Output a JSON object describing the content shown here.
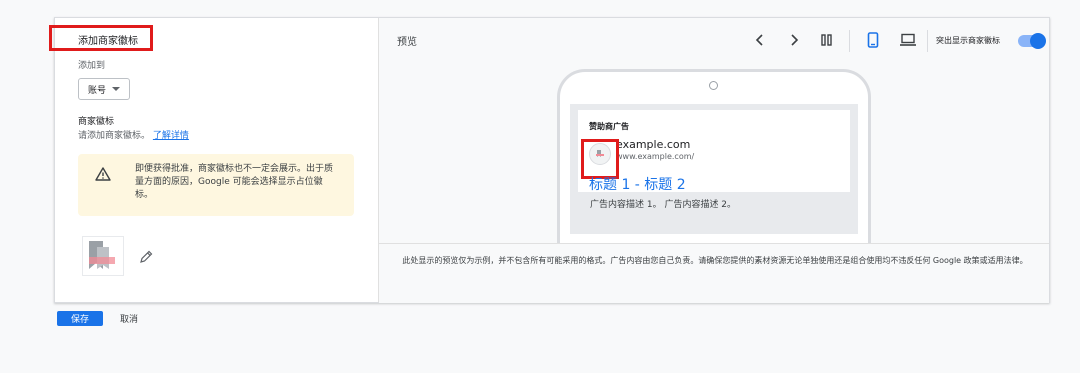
{
  "left_panel": {
    "title": "添加商家徽标",
    "add_to_label": "添加到",
    "dropdown_value": "账号",
    "logo_section_title": "商家徽标",
    "logo_hint": "请添加商家徽标。",
    "learn_more": "了解详情",
    "warning": "即便获得批准，商家徽标也不一定会展示。出于质量方面的原因，Google 可能会选择显示占位徽标。"
  },
  "preview": {
    "title": "预览",
    "toolbar_icons": [
      "chevron-left-icon",
      "chevron-right-icon",
      "columns-icon",
      "mobile-icon",
      "laptop-icon"
    ],
    "highlight_toggle_label": "突出显示商家徽标",
    "highlight_toggle_on": true,
    "ad": {
      "label": "赞助商广告",
      "domain": "example.com",
      "url": "www.example.com/",
      "headline": "标题 1 - 标题 2",
      "description": "广告内容描述 1。 广告内容描述 2。"
    },
    "disclaimer": "此处显示的预览仅为示例，并不包含所有可能采用的格式。广告内容由您自己负责。请确保您提供的素材资源无论单独使用还是组合使用均不违反任何 Google 政策或适用法律。"
  },
  "actions": {
    "save": "保存",
    "cancel": "取消"
  },
  "colors": {
    "accent": "#1a73e8",
    "highlight": "#e01b1b",
    "warning_bg": "#fef7e0"
  }
}
